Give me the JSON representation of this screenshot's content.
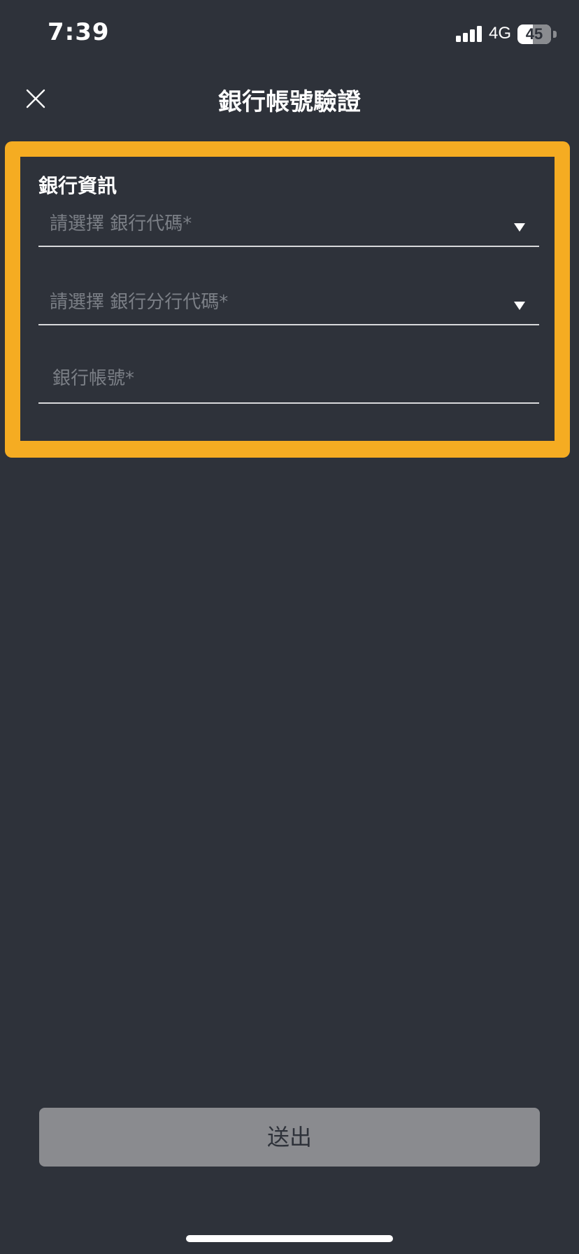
{
  "status_bar": {
    "time": "7:39",
    "network": "4G",
    "battery": "45",
    "battery_level": 0.45,
    "signal_icon": "cellular-signal-icon"
  },
  "header": {
    "title": "銀行帳號驗證",
    "close_icon": "close-icon"
  },
  "bank_info": {
    "section_title": "銀行資訊",
    "bank_code_placeholder": "請選擇 銀行代碼*",
    "branch_code_placeholder": "請選擇 銀行分行代碼*",
    "account_placeholder": "銀行帳號*",
    "account_value": "",
    "dropdown_icon": "triangle-down-icon"
  },
  "footer": {
    "submit_label": "送出"
  },
  "colors": {
    "background": "#2e323a",
    "highlight": "#f5ac22",
    "disabled_button": "#8a8b8f",
    "placeholder": "#7b7f86"
  }
}
